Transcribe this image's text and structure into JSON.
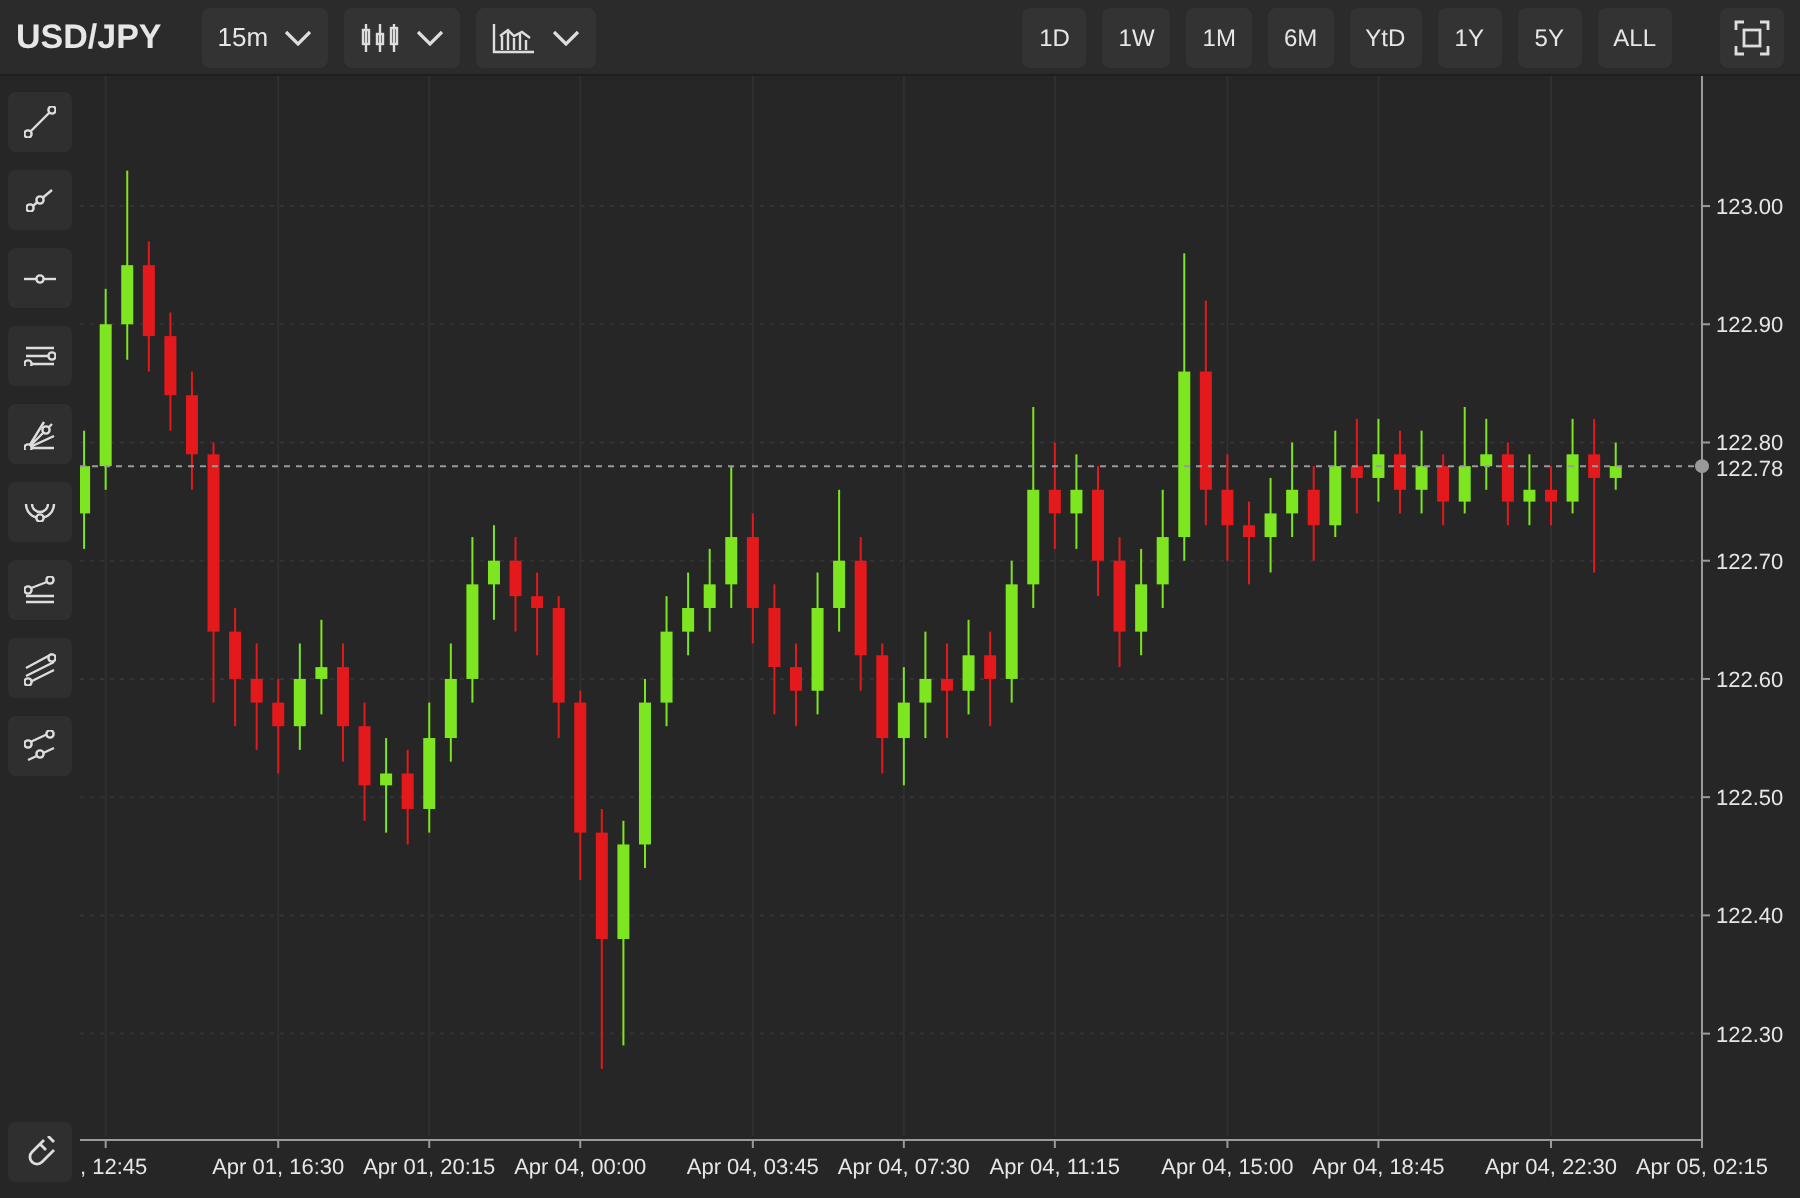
{
  "header": {
    "symbol": "USD/JPY",
    "interval": "15m"
  },
  "ranges": [
    "1D",
    "1W",
    "1M",
    "6M",
    "YtD",
    "1Y",
    "5Y",
    "ALL"
  ],
  "chart_data": {
    "type": "candlestick",
    "grid": true,
    "ylim": [
      122.21,
      123.11
    ],
    "categories": [
      null,
      ", 12:45",
      null,
      null,
      null,
      null,
      null,
      null,
      null,
      "Apr 01, 16:30",
      null,
      null,
      null,
      null,
      null,
      null,
      "Apr 01, 20:15",
      null,
      null,
      null,
      null,
      null,
      null,
      "Apr 04, 00:00",
      null,
      null,
      null,
      null,
      null,
      null,
      null,
      "Apr 04, 03:45",
      null,
      null,
      null,
      null,
      null,
      null,
      "Apr 04, 07:30",
      null,
      null,
      null,
      null,
      null,
      null,
      "Apr 04, 11:15",
      null,
      null,
      null,
      null,
      null,
      null,
      null,
      "Apr 04, 15:00",
      null,
      null,
      null,
      null,
      null,
      null,
      "Apr 04, 18:45",
      null,
      null,
      null,
      null,
      null,
      null,
      null,
      "Apr 04, 22:30",
      null,
      null,
      null,
      null,
      null,
      null,
      "Apr 05, 02:15"
    ],
    "ohlc": [
      [
        122.74,
        122.81,
        122.71,
        122.78
      ],
      [
        122.78,
        122.93,
        122.76,
        122.9
      ],
      [
        122.9,
        123.03,
        122.87,
        122.95
      ],
      [
        122.95,
        122.97,
        122.86,
        122.89
      ],
      [
        122.89,
        122.91,
        122.81,
        122.84
      ],
      [
        122.84,
        122.86,
        122.76,
        122.79
      ],
      [
        122.79,
        122.8,
        122.58,
        122.64
      ],
      [
        122.64,
        122.66,
        122.56,
        122.6
      ],
      [
        122.6,
        122.63,
        122.54,
        122.58
      ],
      [
        122.58,
        122.6,
        122.52,
        122.56
      ],
      [
        122.56,
        122.63,
        122.54,
        122.6
      ],
      [
        122.6,
        122.65,
        122.57,
        122.61
      ],
      [
        122.61,
        122.63,
        122.53,
        122.56
      ],
      [
        122.56,
        122.58,
        122.48,
        122.51
      ],
      [
        122.51,
        122.55,
        122.47,
        122.52
      ],
      [
        122.52,
        122.54,
        122.46,
        122.49
      ],
      [
        122.49,
        122.58,
        122.47,
        122.55
      ],
      [
        122.55,
        122.63,
        122.53,
        122.6
      ],
      [
        122.6,
        122.72,
        122.58,
        122.68
      ],
      [
        122.68,
        122.73,
        122.65,
        122.7
      ],
      [
        122.7,
        122.72,
        122.64,
        122.67
      ],
      [
        122.67,
        122.69,
        122.62,
        122.66
      ],
      [
        122.66,
        122.67,
        122.55,
        122.58
      ],
      [
        122.58,
        122.59,
        122.43,
        122.47
      ],
      [
        122.47,
        122.49,
        122.27,
        122.38
      ],
      [
        122.38,
        122.48,
        122.29,
        122.46
      ],
      [
        122.46,
        122.6,
        122.44,
        122.58
      ],
      [
        122.58,
        122.67,
        122.56,
        122.64
      ],
      [
        122.64,
        122.69,
        122.62,
        122.66
      ],
      [
        122.66,
        122.71,
        122.64,
        122.68
      ],
      [
        122.68,
        122.78,
        122.66,
        122.72
      ],
      [
        122.72,
        122.74,
        122.63,
        122.66
      ],
      [
        122.66,
        122.68,
        122.57,
        122.61
      ],
      [
        122.61,
        122.63,
        122.56,
        122.59
      ],
      [
        122.59,
        122.69,
        122.57,
        122.66
      ],
      [
        122.66,
        122.76,
        122.64,
        122.7
      ],
      [
        122.7,
        122.72,
        122.59,
        122.62
      ],
      [
        122.62,
        122.63,
        122.52,
        122.55
      ],
      [
        122.55,
        122.61,
        122.51,
        122.58
      ],
      [
        122.58,
        122.64,
        122.55,
        122.6
      ],
      [
        122.6,
        122.63,
        122.55,
        122.59
      ],
      [
        122.59,
        122.65,
        122.57,
        122.62
      ],
      [
        122.62,
        122.64,
        122.56,
        122.6
      ],
      [
        122.6,
        122.7,
        122.58,
        122.68
      ],
      [
        122.68,
        122.83,
        122.66,
        122.76
      ],
      [
        122.76,
        122.8,
        122.71,
        122.74
      ],
      [
        122.74,
        122.79,
        122.71,
        122.76
      ],
      [
        122.76,
        122.78,
        122.67,
        122.7
      ],
      [
        122.7,
        122.72,
        122.61,
        122.64
      ],
      [
        122.64,
        122.71,
        122.62,
        122.68
      ],
      [
        122.68,
        122.76,
        122.66,
        122.72
      ],
      [
        122.72,
        122.96,
        122.7,
        122.86
      ],
      [
        122.86,
        122.92,
        122.73,
        122.76
      ],
      [
        122.76,
        122.79,
        122.7,
        122.73
      ],
      [
        122.73,
        122.75,
        122.68,
        122.72
      ],
      [
        122.72,
        122.77,
        122.69,
        122.74
      ],
      [
        122.74,
        122.8,
        122.72,
        122.76
      ],
      [
        122.76,
        122.78,
        122.7,
        122.73
      ],
      [
        122.73,
        122.81,
        122.72,
        122.78
      ],
      [
        122.78,
        122.82,
        122.74,
        122.77
      ],
      [
        122.77,
        122.82,
        122.75,
        122.79
      ],
      [
        122.79,
        122.81,
        122.74,
        122.76
      ],
      [
        122.76,
        122.81,
        122.74,
        122.78
      ],
      [
        122.78,
        122.79,
        122.73,
        122.75
      ],
      [
        122.75,
        122.83,
        122.74,
        122.78
      ],
      [
        122.78,
        122.82,
        122.76,
        122.79
      ],
      [
        122.79,
        122.8,
        122.73,
        122.75
      ],
      [
        122.75,
        122.79,
        122.73,
        122.76
      ],
      [
        122.76,
        122.78,
        122.73,
        122.75
      ],
      [
        122.75,
        122.82,
        122.74,
        122.79
      ],
      [
        122.79,
        122.82,
        122.69,
        122.77
      ],
      [
        122.77,
        122.8,
        122.76,
        122.78
      ],
      null,
      null,
      null,
      null
    ],
    "yticks": [
      {
        "value": 123.0,
        "label": "123.00"
      },
      {
        "value": 122.9,
        "label": "122.90"
      },
      {
        "value": 122.8,
        "label": "122.80"
      },
      {
        "value": 122.7,
        "label": "122.70"
      },
      {
        "value": 122.6,
        "label": "122.60"
      },
      {
        "value": 122.5,
        "label": "122.50"
      },
      {
        "value": 122.4,
        "label": "122.40"
      },
      {
        "value": 122.3,
        "label": "122.30"
      }
    ],
    "ref_lines": [
      {
        "axis": "y",
        "value": 122.78,
        "label": "122.78"
      }
    ]
  }
}
